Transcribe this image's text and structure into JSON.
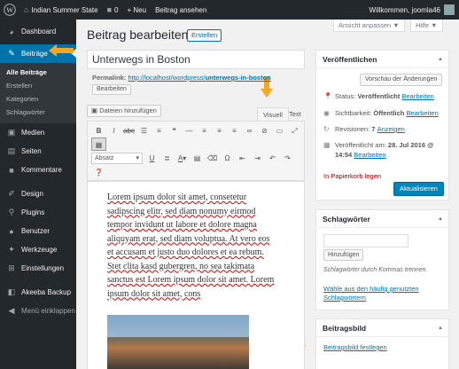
{
  "adminbar": {
    "site_name": "Indian Summer State",
    "comments_count": "0",
    "new_label": "+ Neu",
    "view_post": "Beitrag ansehen",
    "welcome": "Willkommen, joomla46"
  },
  "sidebar": {
    "items": [
      {
        "label": "Dashboard",
        "icon": "dashboard-icon"
      },
      {
        "label": "Beiträge",
        "icon": "pin-icon"
      },
      {
        "label": "Medien",
        "icon": "media-icon"
      },
      {
        "label": "Seiten",
        "icon": "pages-icon"
      },
      {
        "label": "Kommentare",
        "icon": "comments-icon"
      },
      {
        "label": "Design",
        "icon": "brush-icon"
      },
      {
        "label": "Plugins",
        "icon": "plugin-icon"
      },
      {
        "label": "Benutzer",
        "icon": "users-icon"
      },
      {
        "label": "Werkzeuge",
        "icon": "wrench-icon"
      },
      {
        "label": "Einstellungen",
        "icon": "settings-icon"
      },
      {
        "label": "Akeeba Backup",
        "icon": "backup-icon"
      },
      {
        "label": "Menü einklappen",
        "icon": "collapse-icon"
      }
    ],
    "submenu": [
      "Alle Beiträge",
      "Erstellen",
      "Kategorien",
      "Schlagwörter"
    ]
  },
  "screen": {
    "options": "Ansicht anpassen ▼",
    "help": "Hilfe ▼"
  },
  "header": {
    "title": "Beitrag bearbeiten",
    "add_new": "Erstellen"
  },
  "post": {
    "title": "Unterwegs in Boston",
    "permalink_label": "Permalink:",
    "permalink_base": "http://localhost/wordpress/",
    "permalink_slug": "unterwegs-in-boston",
    "permalink_edit": "Bearbeiten"
  },
  "editor": {
    "add_media": "Dateien hinzufügen",
    "tab_visual": "Visuell",
    "tab_text": "Text",
    "format_select": "Absatz",
    "content_lines": [
      "Lorem ipsum dolor sit amet, consetetur",
      "sadipscing elitr, sed diam nonumy eirmod",
      "tempor invidunt ut labore et dolore magna",
      "aliquyam erat, sed diam voluptua. At vero eos",
      "et accusam et justo duo dolores et ea rebum.",
      "Stet clita kasd gubergren, no sea takimata",
      "sanctus est Lorem ipsum dolor sit amet. Lorem",
      "ipsum dolor sit amet, cons"
    ]
  },
  "publish": {
    "title": "Veröffentlichen",
    "preview": "Vorschau der Änderungen",
    "status_label": "Status:",
    "status_value": "Veröffentlicht",
    "visibility_label": "Sichtbarkeit:",
    "visibility_value": "Öffentlich",
    "revisions_label": "Revisionen:",
    "revisions_value": "7",
    "revisions_link": "Anzeigen",
    "published_label": "Veröffentlicht am:",
    "published_date": "28. Jul 2016 @",
    "published_time": "14:54",
    "edit": "Bearbeiten",
    "trash": "In Papierkorb legen",
    "update": "Aktualisieren"
  },
  "tags": {
    "title": "Schlagwörter",
    "add": "Hinzufügen",
    "hint": "Schlagwörter durch Kommas trennen.",
    "choose_line1": "Wähle aus den häufig genutzten",
    "choose_line2": "Schlagwörtern"
  },
  "featured": {
    "title": "Beitragsbild",
    "set": "Beitragsbild festlegen"
  },
  "colors": {
    "accent": "#0073aa",
    "arrow": "#f5a623",
    "adminbar": "#23282d"
  }
}
